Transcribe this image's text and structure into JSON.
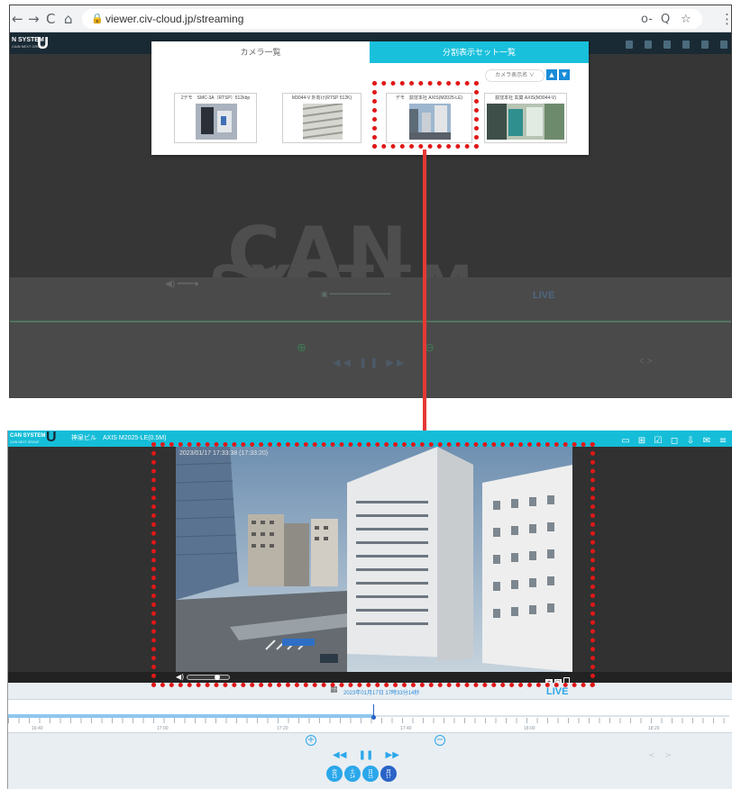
{
  "browser": {
    "url": "viewer.civ-cloud.jp/streaming",
    "back": "←",
    "forward": "→",
    "reload": "C",
    "home": "⌂",
    "key_icon": "o-",
    "zoom_icon": "Q",
    "star_icon": "☆",
    "menu_icon": "⋮"
  },
  "top_app": {
    "logo_text": "N SYSTEM",
    "logo_sub": "CAIN NEXT GROUP",
    "logo_u": "U",
    "watermark_line1": "CAN",
    "watermark_line2": "SYSTEM",
    "live": "LIVE"
  },
  "popup": {
    "tabs": [
      "カメラ一覧",
      "分割表示セット一覧"
    ],
    "sort_label": "カメラ表示名",
    "cameras": [
      {
        "name": "2デモ　SMC-3A（RTSP）512kbp"
      },
      {
        "name": "M3044-V 外向け(RTSP 512K)"
      },
      {
        "name": "デモ　荻窪本社 AXIS(M2025-LE)"
      },
      {
        "name": "荻窪本社 玄関 AXIS(M3044-V)"
      }
    ]
  },
  "bottom_app": {
    "logo_text": "CAN SYSTEM",
    "logo_sub": "CAIN NEXT GROUP",
    "logo_u": "U",
    "camera_title": "神泉ビル　AXIS M2025-LE(0.5M)",
    "video_stamp": "2023/01/17 17:33:38 (17:33:20)",
    "datetime": "2023年01月17日 17時33分14秒",
    "live": "LIVE",
    "time_labels": [
      "16:40",
      "17:00",
      "17:20",
      "17:40",
      "18:00",
      "18:20"
    ],
    "days": [
      {
        "top": "金",
        "bottom": "13"
      },
      {
        "top": "土",
        "bottom": "14"
      },
      {
        "top": "日",
        "bottom": "15"
      },
      {
        "top": "月",
        "bottom": "17"
      }
    ],
    "playback": {
      "rewind": "◀◀",
      "pause": "❚❚",
      "forward": "▶▶"
    },
    "zoom_in": "+",
    "zoom_out": "−",
    "nav_prev_next": "< >"
  },
  "colors": {
    "accent": "#15bdd8",
    "highlight": "#e01818",
    "arrow": "#e53935"
  }
}
